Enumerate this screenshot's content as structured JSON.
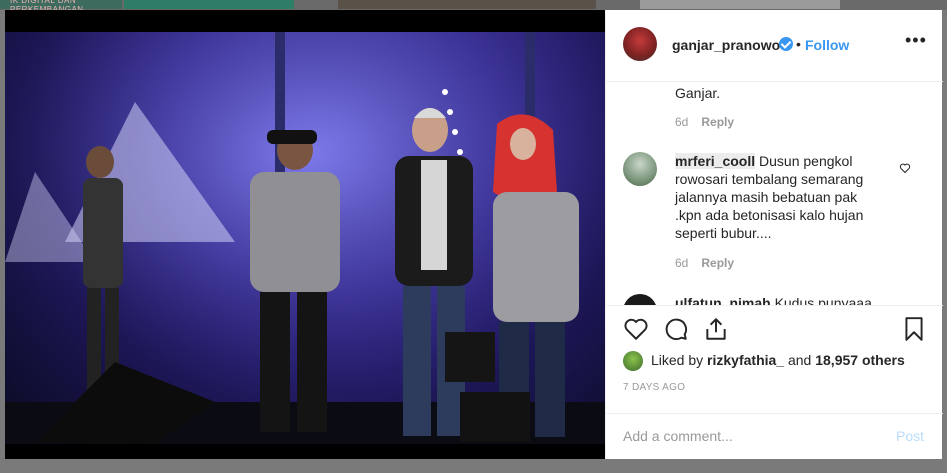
{
  "background": {
    "thumb_text": "IK  DIGITAL DAN PERKEMBANGAN..."
  },
  "post": {
    "username": "ganjar_pranowo",
    "dot": "•",
    "follow_label": "Follow",
    "more_label": "•••",
    "accent_color": "#3897f0"
  },
  "comments": [
    {
      "user": "",
      "text": "Ganjar.",
      "age": "6d",
      "reply_label": "Reply"
    },
    {
      "user": "mrferi_cooll",
      "text": "Dusun pengkol rowosari tembalang semarang jalannya masih bebatuan pak .kpn ada betonisasi kalo hujan seperti bubur....",
      "age": "6d",
      "reply_label": "Reply"
    },
    {
      "user": "ulfatun_nimah",
      "text": "Kudus punyaaa"
    }
  ],
  "actions": {
    "icons": [
      "heart-icon",
      "comment-icon",
      "share-icon",
      "bookmark-icon"
    ],
    "liked_prefix": "Liked by",
    "liked_user": "rizkyfathia_",
    "liked_and": "and",
    "liked_count": "18,957 others",
    "date": "7 DAYS AGO"
  },
  "add_comment": {
    "placeholder": "Add a comment...",
    "post_label": "Post"
  }
}
